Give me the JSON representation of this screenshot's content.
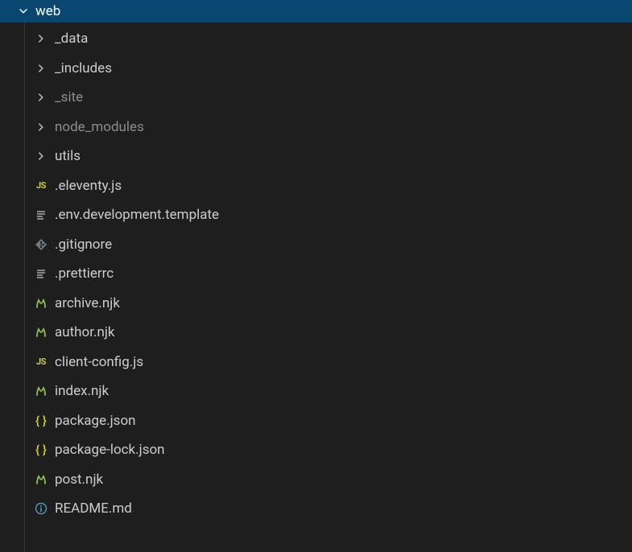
{
  "header": {
    "title": "web"
  },
  "tree": {
    "items": [
      {
        "type": "folder",
        "label": "_data",
        "dimmed": false
      },
      {
        "type": "folder",
        "label": "_includes",
        "dimmed": false
      },
      {
        "type": "folder",
        "label": "_site",
        "dimmed": true
      },
      {
        "type": "folder",
        "label": "node_modules",
        "dimmed": true
      },
      {
        "type": "folder",
        "label": "utils",
        "dimmed": false
      },
      {
        "type": "file",
        "icon": "js",
        "label": ".eleventy.js"
      },
      {
        "type": "file",
        "icon": "text",
        "label": ".env.development.template"
      },
      {
        "type": "file",
        "icon": "git",
        "label": ".gitignore"
      },
      {
        "type": "file",
        "icon": "text",
        "label": ".prettierrc"
      },
      {
        "type": "file",
        "icon": "njk",
        "label": "archive.njk"
      },
      {
        "type": "file",
        "icon": "njk",
        "label": "author.njk"
      },
      {
        "type": "file",
        "icon": "js",
        "label": "client-config.js"
      },
      {
        "type": "file",
        "icon": "njk",
        "label": "index.njk"
      },
      {
        "type": "file",
        "icon": "json",
        "label": "package.json"
      },
      {
        "type": "file",
        "icon": "json",
        "label": "package-lock.json"
      },
      {
        "type": "file",
        "icon": "njk",
        "label": "post.njk"
      },
      {
        "type": "file",
        "icon": "info",
        "label": "README.md"
      }
    ]
  }
}
